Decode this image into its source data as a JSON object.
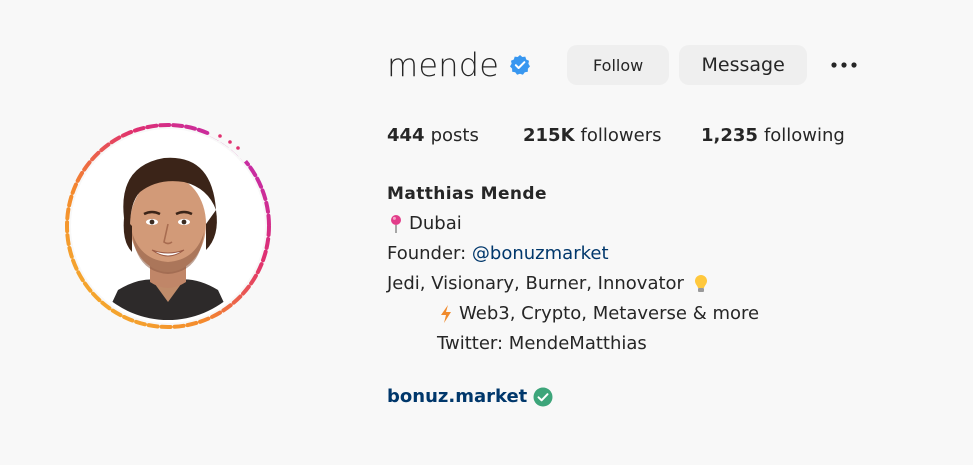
{
  "profile": {
    "username": "mende",
    "verified": true
  },
  "actions": {
    "follow_label": "Follow",
    "message_label": "Message",
    "more_icon": "more-horizontal-icon"
  },
  "stats": {
    "posts_count": "444",
    "posts_label": "posts",
    "followers_count": "215K",
    "followers_label": "followers",
    "following_count": "1,235",
    "following_label": "following"
  },
  "bio": {
    "full_name": "Matthias Mende",
    "location": "Dubai",
    "founder_prefix": "Founder: ",
    "founder_mention": "@bonuzmarket",
    "tagline": "Jedi, Visionary, Burner, Innovator",
    "interests": "Web3, Crypto, Metaverse & more",
    "twitter": "Twitter: MendeMatthias"
  },
  "website": {
    "text": "bonuz.market",
    "verified_icon": "check-circle-icon"
  },
  "colors": {
    "verified_blue": "#3897f0",
    "link_color": "#00376b",
    "button_bg": "#efefef",
    "check_green": "#3da57a"
  }
}
